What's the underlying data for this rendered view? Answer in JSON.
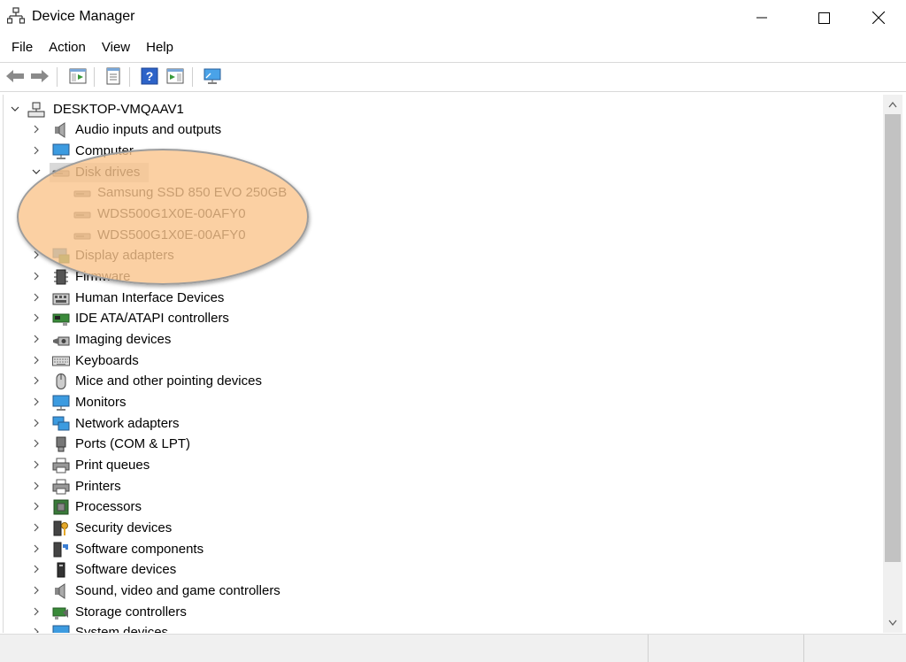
{
  "window": {
    "title": "Device Manager"
  },
  "menu": [
    "File",
    "Action",
    "View",
    "Help"
  ],
  "tree": {
    "root": "DESKTOP-VMQAAV1",
    "items": [
      {
        "label": "Audio inputs and outputs",
        "icon": "speaker-icon",
        "expanded": false
      },
      {
        "label": "Computer",
        "icon": "monitor-icon",
        "expanded": false
      },
      {
        "label": "Disk drives",
        "icon": "disk-drive-icon",
        "expanded": true,
        "selected": true,
        "children": [
          "Samsung SSD 850 EVO 250GB",
          "WDS500G1X0E-00AFY0",
          "WDS500G1X0E-00AFY0"
        ]
      },
      {
        "label": "Display adapters",
        "icon": "display-adapter-icon",
        "expanded": false
      },
      {
        "label": "Firmware",
        "icon": "firmware-icon",
        "expanded": false
      },
      {
        "label": "Human Interface Devices",
        "icon": "hid-icon",
        "expanded": false
      },
      {
        "label": "IDE ATA/ATAPI controllers",
        "icon": "controller-icon",
        "expanded": false
      },
      {
        "label": "Imaging devices",
        "icon": "camera-icon",
        "expanded": false
      },
      {
        "label": "Keyboards",
        "icon": "keyboard-icon",
        "expanded": false
      },
      {
        "label": "Mice and other pointing devices",
        "icon": "mouse-icon",
        "expanded": false
      },
      {
        "label": "Monitors",
        "icon": "monitor-icon",
        "expanded": false
      },
      {
        "label": "Network adapters",
        "icon": "network-icon",
        "expanded": false
      },
      {
        "label": "Ports (COM & LPT)",
        "icon": "port-icon",
        "expanded": false
      },
      {
        "label": "Print queues",
        "icon": "printer-icon",
        "expanded": false
      },
      {
        "label": "Printers",
        "icon": "printer-icon",
        "expanded": false
      },
      {
        "label": "Processors",
        "icon": "processor-icon",
        "expanded": false
      },
      {
        "label": "Security devices",
        "icon": "security-key-icon",
        "expanded": false
      },
      {
        "label": "Software components",
        "icon": "software-component-icon",
        "expanded": false
      },
      {
        "label": "Software devices",
        "icon": "software-device-icon",
        "expanded": false
      },
      {
        "label": "Sound, video and game controllers",
        "icon": "speaker-icon",
        "expanded": false
      },
      {
        "label": "Storage controllers",
        "icon": "storage-controller-icon",
        "expanded": false
      },
      {
        "label": "System devices",
        "icon": "system-device-icon",
        "expanded": false
      }
    ]
  },
  "colors": {
    "highlight": "#fac48c",
    "selection": "#d9d9d9",
    "accent": "#2a7fd4"
  }
}
